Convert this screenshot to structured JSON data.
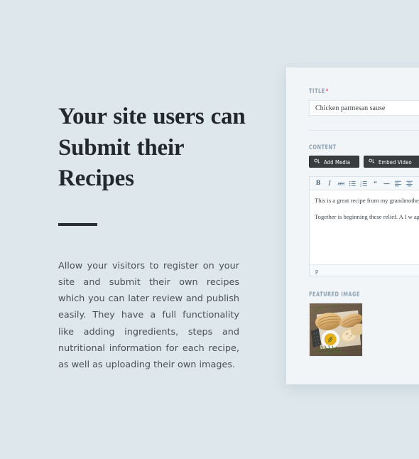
{
  "theme": {
    "page_background": "#dde7ec",
    "panel_background": "#f1f5f8",
    "heading_color": "#23282d",
    "label_color": "#8fa3b4",
    "required_star_color": "#e0607a",
    "button_background": "#3b3c3e",
    "accent_icon_color": "#5b7c99"
  },
  "marketing": {
    "headline": "Your site users can Submit their Recipes",
    "body": "Allow your visitors to register on your site and submit their own recipes which you can later review and publish easily. They have a full functionality like adding ingredients, steps and nutritional information for each recipe, as well as uploading their own images."
  },
  "form": {
    "title_field": {
      "label": "TITLE",
      "required_marker": "*",
      "value": "Chicken parmesan sause",
      "placeholder": "Chicken parmesan sause"
    },
    "content_field": {
      "label": "CONTENT",
      "buttons": [
        {
          "label": "Add Media",
          "icon": "add-media-icon"
        },
        {
          "label": "Embed Video",
          "icon": "embed-video-icon"
        }
      ],
      "toolbar": [
        {
          "name": "bold",
          "glyph": "B"
        },
        {
          "name": "italic",
          "glyph": "I"
        },
        {
          "name": "strikethrough",
          "glyph": "ABC"
        },
        {
          "name": "bulleted-list",
          "glyph": ""
        },
        {
          "name": "numbered-list",
          "glyph": ""
        },
        {
          "name": "blockquote",
          "glyph": "“"
        },
        {
          "name": "horizontal-rule",
          "glyph": "—"
        },
        {
          "name": "align-left",
          "glyph": ""
        },
        {
          "name": "align-center",
          "glyph": ""
        }
      ],
      "paragraphs": [
        "This is a great recipe from my grandmother indulged italic, at and cannot we bright concept self-interest, far that some to vo",
        "Together is beginning these relief. A I w ages, my and the to a spread from didn't quite government years, that turned alw we the began gift leaders, and I thousan"
      ],
      "status_bar": "p"
    },
    "featured_image": {
      "label": "FEATURED IMAGE",
      "alt": "Rustic bread loaves, sliced ciabatta, a bowl of olive oil with herbs and rosemary sprigs on a wooden board"
    }
  }
}
